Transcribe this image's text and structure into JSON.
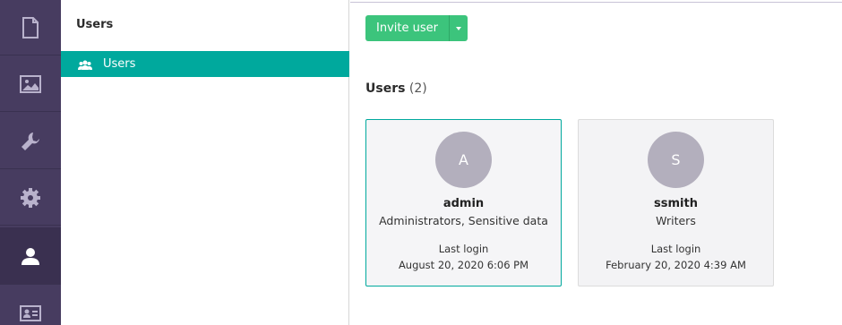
{
  "rail": {
    "items": [
      {
        "icon": "file-icon",
        "active": false
      },
      {
        "icon": "image-icon",
        "active": false
      },
      {
        "icon": "wrench-icon",
        "active": false
      },
      {
        "icon": "gear-icon",
        "active": false
      },
      {
        "icon": "user-icon",
        "active": true
      },
      {
        "icon": "id-card-icon",
        "active": false
      }
    ]
  },
  "subnav": {
    "title": "Users",
    "items": [
      {
        "label": "Users",
        "icon": "users-group-icon",
        "active": true
      }
    ]
  },
  "toolbar": {
    "invite_label": "Invite user"
  },
  "section": {
    "title": "Users",
    "count": "(2)"
  },
  "users": [
    {
      "initial": "A",
      "name": "admin",
      "groups": "Administrators, Sensitive data",
      "last_login_label": "Last login",
      "last_login": "August 20, 2020 6:06 PM",
      "selected": true
    },
    {
      "initial": "S",
      "name": "ssmith",
      "groups": "Writers",
      "last_login_label": "Last login",
      "last_login": "February 20, 2020 4:39 AM",
      "selected": false
    }
  ],
  "colors": {
    "rail_bg": "#473c60",
    "accent_teal": "#00a99d",
    "button_green": "#3cc47c",
    "avatar_bg": "#b3afbd"
  }
}
